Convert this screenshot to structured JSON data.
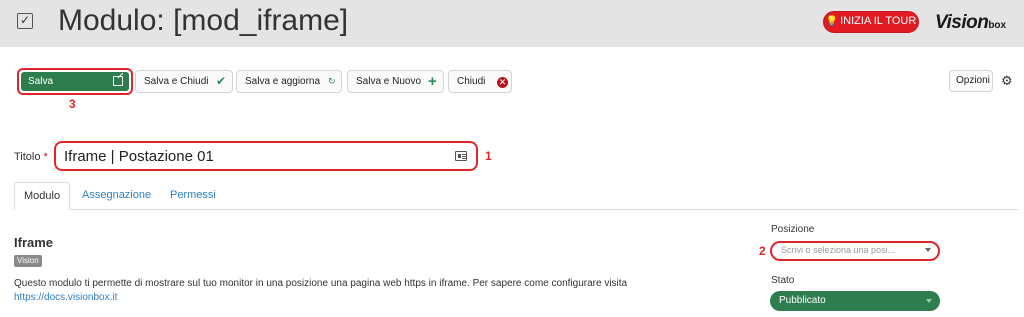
{
  "header": {
    "title": "Modulo: [mod_iframe]",
    "tour_label": "INIZIA IL TOUR",
    "brand_main": "Vision",
    "brand_sub": "box"
  },
  "toolbar": {
    "save_label": "Salva",
    "save_close_label": "Salva e Chiudi",
    "save_update_label": "Salva e aggiorna",
    "save_new_label": "Salva e Nuovo",
    "close_label": "Chiudi",
    "options_label": "Opzioni"
  },
  "callouts": {
    "one": "1",
    "two": "2",
    "three": "3"
  },
  "form": {
    "title_label": "Titolo",
    "title_required": "*",
    "title_value": "Iframe | Postazione 01"
  },
  "tabs": [
    {
      "label": "Modulo",
      "active": true
    },
    {
      "label": "Assegnazione",
      "active": false
    },
    {
      "label": "Permessi",
      "active": false
    }
  ],
  "module": {
    "heading": "Iframe",
    "badge": "Vision",
    "description": "Questo modulo ti permette di mostrare sul tuo monitor in una posizione una pagina web https in iframe. Per sapere come configurare visita",
    "link": "https://docs.visionbox.it"
  },
  "side": {
    "position_label": "Posizione",
    "position_placeholder": "Scrivi o seleziona una posi...",
    "state_label": "Stato",
    "state_value": "Pubblicato"
  },
  "colors": {
    "header_bg": "#e4e4e4",
    "save_green": "#2e7d4f",
    "tour_red": "#e21b23",
    "callout_red": "#e0262d",
    "link_blue": "#2f7fc1"
  },
  "icons": {
    "header": "checkbox-icon",
    "tour": "lightbulb-icon",
    "save": "edit-icon",
    "save_close": "check-icon",
    "save_update": "refresh-icon",
    "save_new": "plus-icon",
    "close": "close-circle-icon",
    "options": "gear-icon",
    "title_field": "id-card-icon"
  }
}
